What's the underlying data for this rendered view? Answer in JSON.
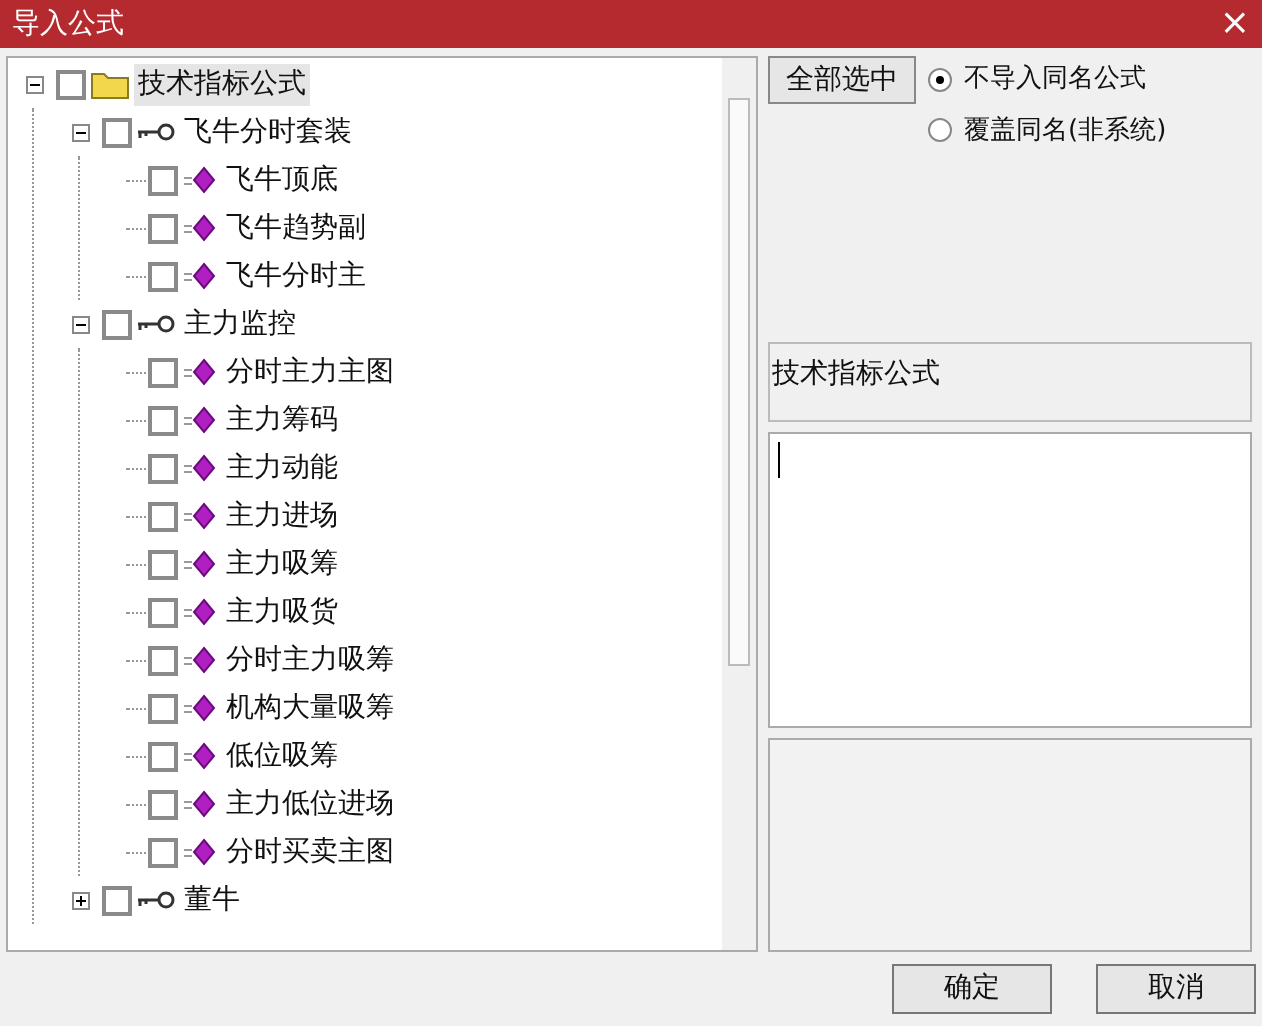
{
  "window": {
    "title": "导入公式",
    "close": "×"
  },
  "tree": [
    {
      "label": "技术指标公式",
      "kind": "folder",
      "checked": false,
      "selected": true,
      "expanded": true,
      "children": [
        {
          "label": "飞牛分时套装",
          "kind": "group",
          "checked": false,
          "selected": false,
          "expanded": true,
          "children": [
            {
              "label": "飞牛顶底",
              "kind": "formula",
              "checked": false,
              "selected": false
            },
            {
              "label": "飞牛趋势副",
              "kind": "formula",
              "checked": false,
              "selected": false
            },
            {
              "label": "飞牛分时主",
              "kind": "formula",
              "checked": false,
              "selected": false
            }
          ]
        },
        {
          "label": "主力监控",
          "kind": "group",
          "checked": false,
          "selected": false,
          "expanded": true,
          "children": [
            {
              "label": "分时主力主图",
              "kind": "formula",
              "checked": false,
              "selected": false
            },
            {
              "label": "主力筹码",
              "kind": "formula",
              "checked": false,
              "selected": false
            },
            {
              "label": "主力动能",
              "kind": "formula",
              "checked": false,
              "selected": false
            },
            {
              "label": "主力进场",
              "kind": "formula",
              "checked": false,
              "selected": false
            },
            {
              "label": "主力吸筹",
              "kind": "formula",
              "checked": false,
              "selected": false
            },
            {
              "label": "主力吸货",
              "kind": "formula",
              "checked": false,
              "selected": false
            },
            {
              "label": "分时主力吸筹",
              "kind": "formula",
              "checked": false,
              "selected": false
            },
            {
              "label": "机构大量吸筹",
              "kind": "formula",
              "checked": false,
              "selected": false
            },
            {
              "label": "低位吸筹",
              "kind": "formula",
              "checked": false,
              "selected": false
            },
            {
              "label": "主力低位进场",
              "kind": "formula",
              "checked": false,
              "selected": false
            },
            {
              "label": "分时买卖主图",
              "kind": "formula",
              "checked": false,
              "selected": false
            }
          ]
        },
        {
          "label": "董牛",
          "kind": "group",
          "checked": false,
          "selected": false,
          "expanded": false
        }
      ]
    }
  ],
  "select_all_button": "全部选中",
  "options": [
    {
      "label": "不导入同名公式",
      "selected": true
    },
    {
      "label": "覆盖同名(非系统)",
      "selected": false
    }
  ],
  "category_label": "技术指标公式",
  "buttons": [
    "确定",
    "取消"
  ]
}
